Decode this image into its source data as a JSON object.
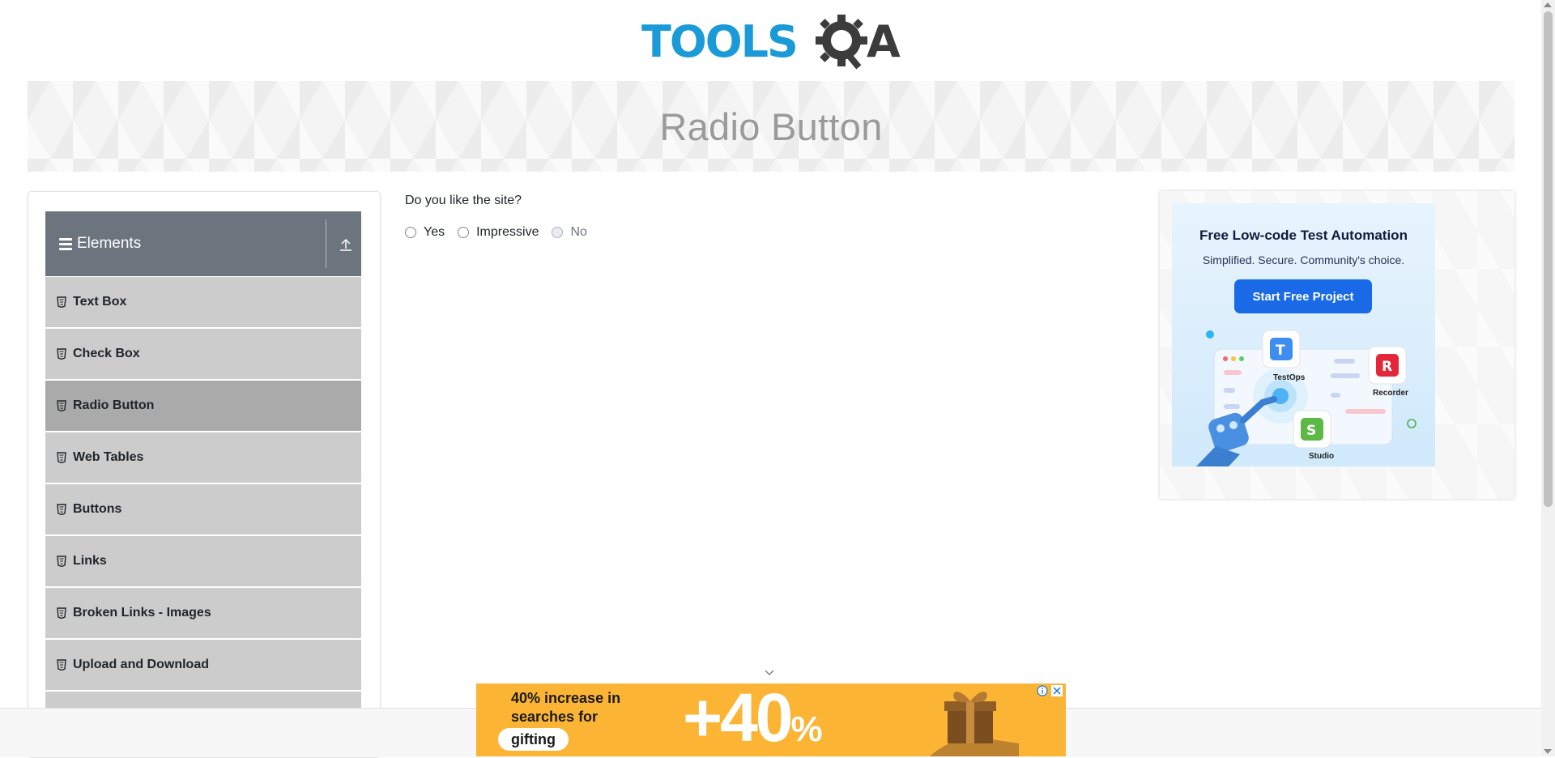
{
  "logo": {
    "text_left": "TOOLS",
    "text_right": "A"
  },
  "page": {
    "title": "Radio Button"
  },
  "sidebar": {
    "group": {
      "label": "Elements"
    },
    "items": [
      {
        "label": "Text Box",
        "active": false
      },
      {
        "label": "Check Box",
        "active": false
      },
      {
        "label": "Radio Button",
        "active": true
      },
      {
        "label": "Web Tables",
        "active": false
      },
      {
        "label": "Buttons",
        "active": false
      },
      {
        "label": "Links",
        "active": false
      },
      {
        "label": "Broken Links - Images",
        "active": false
      },
      {
        "label": "Upload and Download",
        "active": false
      }
    ]
  },
  "form": {
    "question": "Do you like the site?",
    "options": [
      {
        "label": "Yes",
        "checked": false,
        "disabled": false
      },
      {
        "label": "Impressive",
        "checked": false,
        "disabled": false
      },
      {
        "label": "No",
        "checked": false,
        "disabled": true
      }
    ]
  },
  "side_ad": {
    "headline": "Free Low-code Test Automation",
    "subheadline": "Simplified. Secure. Community's choice.",
    "cta": "Start Free Project",
    "tiles": [
      "TestOps",
      "Recorder",
      "Studio"
    ],
    "tile_letters": [
      "T",
      "R",
      "S"
    ]
  },
  "bottom_ad": {
    "line1": "40% increase in",
    "line2": "searches for",
    "pill": "gifting",
    "big_number": "+40",
    "big_unit": "%"
  },
  "colors": {
    "brand_blue": "#1a9bd7",
    "logo_dark": "#3c3c3c",
    "group_header": "#6c757d",
    "menu_item": "#cccccc",
    "menu_item_active": "#aaaaaa",
    "cta_blue": "#1a6ae8",
    "bottom_ad_bg": "#fbb434"
  }
}
